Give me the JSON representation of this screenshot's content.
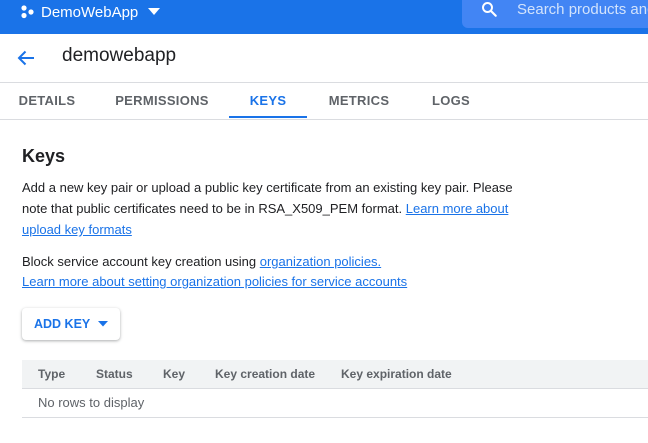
{
  "topbar": {
    "project_name": "DemoWebApp",
    "search_placeholder": "Search products and resources",
    "brand_color": "#1a73e8"
  },
  "page": {
    "title": "demowebapp"
  },
  "tabs": [
    {
      "label": "DETAILS",
      "active": false
    },
    {
      "label": "PERMISSIONS",
      "active": false
    },
    {
      "label": "KEYS",
      "active": true
    },
    {
      "label": "METRICS",
      "active": false
    },
    {
      "label": "LOGS",
      "active": false
    }
  ],
  "keys": {
    "heading": "Keys",
    "description": "Add a new key pair or upload a public key certificate from an existing key pair. Please note that public certificates need to be in RSA_X509_PEM format.",
    "learn_more_formats": "Learn more about upload key formats",
    "block_text": "Block service account key creation using",
    "org_policies_link": "organization policies.",
    "learn_more_policies": "Learn more about setting organization policies for service accounts",
    "add_key_label": "ADD KEY"
  },
  "table": {
    "columns": [
      "Type",
      "Status",
      "Key",
      "Key creation date",
      "Key expiration date"
    ],
    "empty_message": "No rows to display"
  },
  "icons": {
    "project": "project-dots-icon",
    "project_dropdown": "chevron-down-icon",
    "search": "search-icon",
    "back": "back-arrow-icon",
    "add_key_dropdown": "caret-down-icon"
  }
}
